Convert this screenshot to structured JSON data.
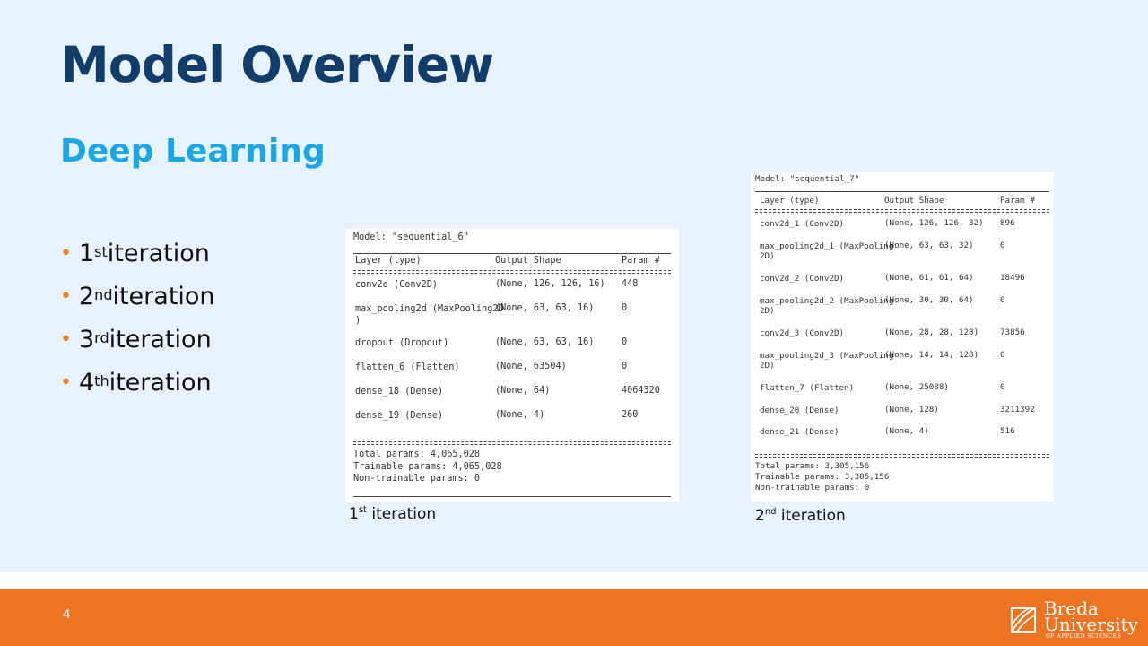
{
  "title": "Model Overview",
  "subtitle": "Deep Learning",
  "bullets": [
    {
      "num": "1",
      "sup": "st",
      "text": " iteration"
    },
    {
      "num": "2",
      "sup": "nd",
      "text": " iteration"
    },
    {
      "num": "3",
      "sup": "rd",
      "text": " iteration"
    },
    {
      "num": "4",
      "sup": "th",
      "text": " iteration"
    }
  ],
  "summary1": {
    "model_line": "Model: \"sequential_6\"",
    "headers": [
      "Layer (type)",
      "Output Shape",
      "Param #"
    ],
    "rows": [
      {
        "layer": "conv2d (Conv2D)",
        "shape": "(None, 126, 126, 16)",
        "params": "448"
      },
      {
        "layer": "max_pooling2d (MaxPooling2D\n)",
        "shape": "(None, 63, 63, 16)",
        "params": "0"
      },
      {
        "layer": "dropout (Dropout)",
        "shape": "(None, 63, 63, 16)",
        "params": "0"
      },
      {
        "layer": "flatten_6 (Flatten)",
        "shape": "(None, 63504)",
        "params": "0"
      },
      {
        "layer": "dense_18 (Dense)",
        "shape": "(None, 64)",
        "params": "4064320"
      },
      {
        "layer": "dense_19 (Dense)",
        "shape": "(None, 4)",
        "params": "260"
      }
    ],
    "total": "Total params: 4,065,028",
    "trainable": "Trainable params: 4,065,028",
    "non_trainable": "Non-trainable params: 0",
    "caption_num": "1",
    "caption_sup": "st",
    "caption_text": " iteration"
  },
  "summary2": {
    "model_line": "Model: \"sequential_7\"",
    "headers": [
      "Layer (type)",
      "Output Shape",
      "Param #"
    ],
    "rows": [
      {
        "layer": "conv2d_1 (Conv2D)",
        "shape": "(None, 126, 126, 32)",
        "params": "896"
      },
      {
        "layer": "max_pooling2d_1 (MaxPooling\n2D)",
        "shape": "(None, 63, 63, 32)",
        "params": "0"
      },
      {
        "layer": "conv2d_2 (Conv2D)",
        "shape": "(None, 61, 61, 64)",
        "params": "18496"
      },
      {
        "layer": "max_pooling2d_2 (MaxPooling\n2D)",
        "shape": "(None, 30, 30, 64)",
        "params": "0"
      },
      {
        "layer": "conv2d_3 (Conv2D)",
        "shape": "(None, 28, 28, 128)",
        "params": "73856"
      },
      {
        "layer": "max_pooling2d_3 (MaxPooling\n2D)",
        "shape": "(None, 14, 14, 128)",
        "params": "0"
      },
      {
        "layer": "flatten_7 (Flatten)",
        "shape": "(None, 25088)",
        "params": "0"
      },
      {
        "layer": "dense_20 (Dense)",
        "shape": "(None, 128)",
        "params": "3211392"
      },
      {
        "layer": "dense_21 (Dense)",
        "shape": "(None, 4)",
        "params": "516"
      }
    ],
    "total": "Total params: 3,305,156",
    "trainable": "Trainable params: 3,305,156",
    "non_trainable": "Non-trainable params: 0",
    "caption_num": "2",
    "caption_sup": "nd",
    "caption_text": " iteration"
  },
  "footer": {
    "page_number": "4",
    "logo_line1": "Breda",
    "logo_line2": "University",
    "logo_line3": "OF APPLIED SCIENCES"
  },
  "colors": {
    "title": "#123c6a",
    "subtitle": "#1aa7e4",
    "accent": "#ec7423",
    "background": "#e8f2fb"
  }
}
